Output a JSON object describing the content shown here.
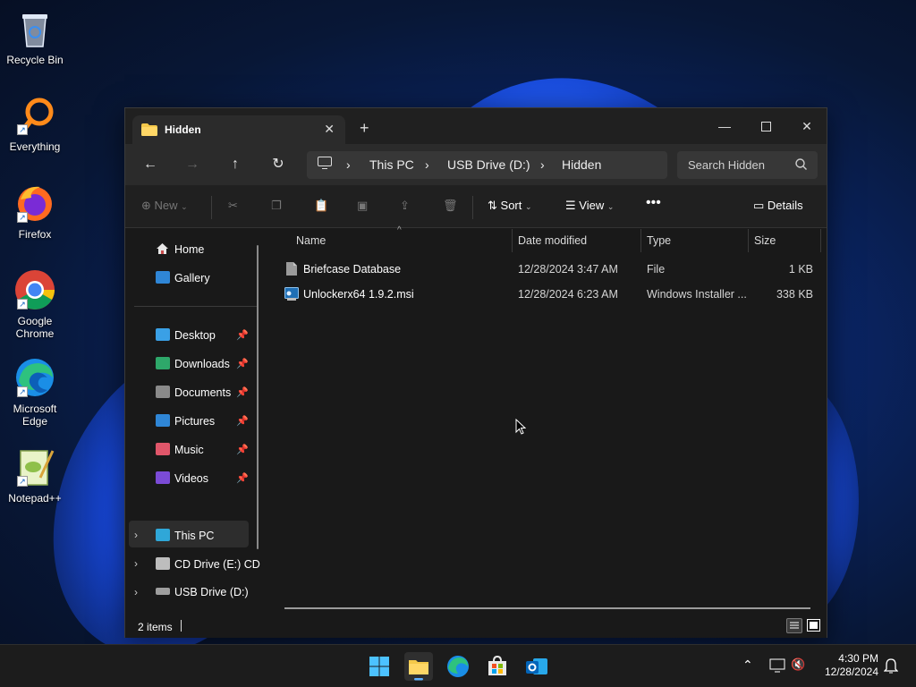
{
  "desktop": {
    "icons": [
      {
        "label": "Recycle Bin"
      },
      {
        "label": "Everything"
      },
      {
        "label": "Firefox"
      },
      {
        "label": "Google Chrome"
      },
      {
        "label": "Microsoft Edge"
      },
      {
        "label": "Notepad++"
      }
    ]
  },
  "window": {
    "tab_title": "Hidden",
    "address": [
      "This PC",
      "USB Drive (D:)",
      "Hidden"
    ],
    "search_placeholder": "Search Hidden",
    "toolbar": {
      "new_label": "New",
      "sort_label": "Sort",
      "view_label": "View",
      "details_label": "Details"
    },
    "sidebar": {
      "top": [
        {
          "label": "Home"
        },
        {
          "label": "Gallery"
        }
      ],
      "quick": [
        {
          "label": "Desktop",
          "color": "#3aa0e6"
        },
        {
          "label": "Downloads",
          "color": "#2ea86a"
        },
        {
          "label": "Documents",
          "color": "#8a8a8a"
        },
        {
          "label": "Pictures",
          "color": "#2f86d6"
        },
        {
          "label": "Music",
          "color": "#e0566a"
        },
        {
          "label": "Videos",
          "color": "#7b4bd6"
        }
      ],
      "drives": [
        {
          "label": "This PC"
        },
        {
          "label": "CD Drive (E:) CD"
        },
        {
          "label": "USB Drive (D:)"
        }
      ]
    },
    "columns": {
      "name": "Name",
      "date": "Date modified",
      "type": "Type",
      "size": "Size"
    },
    "files": [
      {
        "name": "Briefcase Database",
        "date": "12/28/2024 3:47 AM",
        "type": "File",
        "size": "1 KB"
      },
      {
        "name": "Unlockerx64 1.9.2.msi",
        "date": "12/28/2024 6:23 AM",
        "type": "Windows Installer ...",
        "size": "338 KB"
      }
    ],
    "status": "2 items"
  },
  "taskbar": {
    "time": "4:30 PM",
    "date": "12/28/2024"
  }
}
